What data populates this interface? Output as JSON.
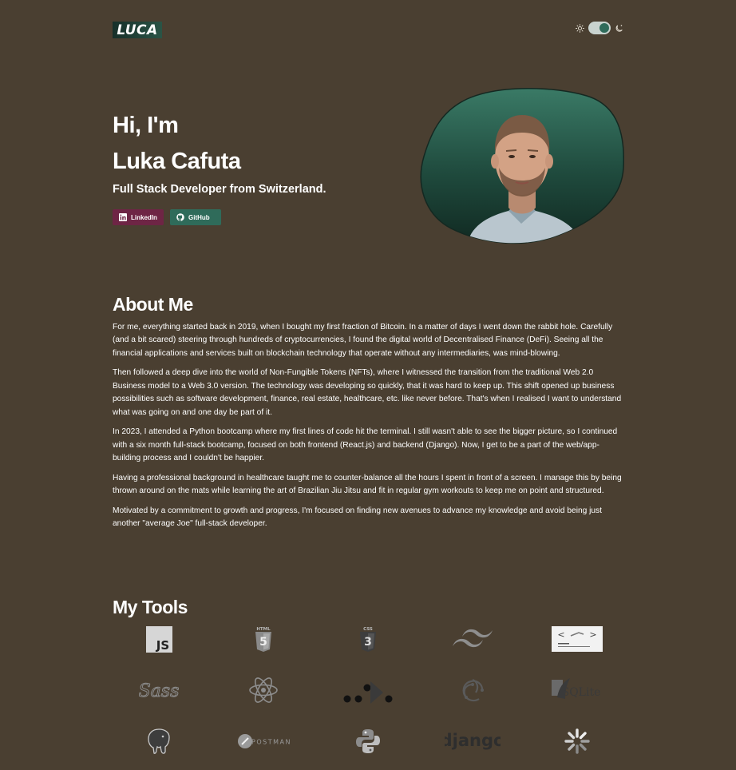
{
  "header": {
    "logo_text": "LUCA",
    "theme_toggle": {
      "light_icon": "sun-icon",
      "dark_icon": "moon-icon",
      "state": "dark"
    }
  },
  "hero": {
    "greeting": "Hi, I'm",
    "name": "Luka Cafuta",
    "subtitle": "Full Stack Developer from Switzerland.",
    "buttons": [
      {
        "label": "LinkedIn",
        "icon": "linkedin-icon",
        "color": "#6e2545"
      },
      {
        "label": "GitHub",
        "icon": "github-icon",
        "color": "#2f6b5a"
      }
    ]
  },
  "about": {
    "title": "About Me",
    "paragraphs": [
      "For me, everything started back in 2019, when I bought my first fraction of Bitcoin. In a matter of days I went down the rabbit hole. Carefully (and a bit scared) steering through hundreds of cryptocurrencies, I found the digital world of Decentralised Finance (DeFi). Seeing all the financial applications and services built on blockchain technology that operate without any intermediaries, was mind-blowing.",
      "Then followed a deep dive into the world of Non-Fungible Tokens (NFTs), where I witnessed the transition from the traditional Web 2.0 Business model to a Web 3.0 version. The technology was developing so quickly, that it was hard to keep up. This shift opened up business possibilities such as software development, finance, real estate, healthcare, etc. like never before. That's when I realised I want to understand what was going on and one day be part of it.",
      "In 2023, I attended a Python bootcamp where my first lines of code hit the terminal. I still wasn't able to see the bigger picture, so I continued with a six month full-stack bootcamp, focused on both frontend (React.js) and backend (Django). Now, I get to be a part of the web/app-building process and I couldn't be happier.",
      "Having a professional background in healthcare taught me to counter-balance all the hours I spent in front of a screen. I manage this by being thrown around on the mats while learning the art of Brazilian Jiu Jitsu and fit in regular gym workouts to keep me on point and structured.",
      "Motivated by a commitment to growth and progress, I'm focused on finding new avenues to advance my knowledge and avoid being just another \"average Joe\" full-stack developer."
    ]
  },
  "tools": {
    "title": "My Tools",
    "items": [
      {
        "name": "javascript-icon",
        "text": "JS"
      },
      {
        "name": "html5-icon",
        "text": "HTML"
      },
      {
        "name": "css3-icon",
        "text": "CSS"
      },
      {
        "name": "tailwind-icon"
      },
      {
        "name": "styled-components-icon"
      },
      {
        "name": "sass-icon",
        "text": "Sass"
      },
      {
        "name": "react-icon"
      },
      {
        "name": "vite-icon"
      },
      {
        "name": "redux-icon"
      },
      {
        "name": "sqlite-icon",
        "text": "SQLite"
      },
      {
        "name": "postgresql-icon"
      },
      {
        "name": "postman-icon",
        "text": "POSTMAN"
      },
      {
        "name": "python-icon"
      },
      {
        "name": "django-icon",
        "text": "django"
      },
      {
        "name": "loader-icon"
      }
    ]
  }
}
